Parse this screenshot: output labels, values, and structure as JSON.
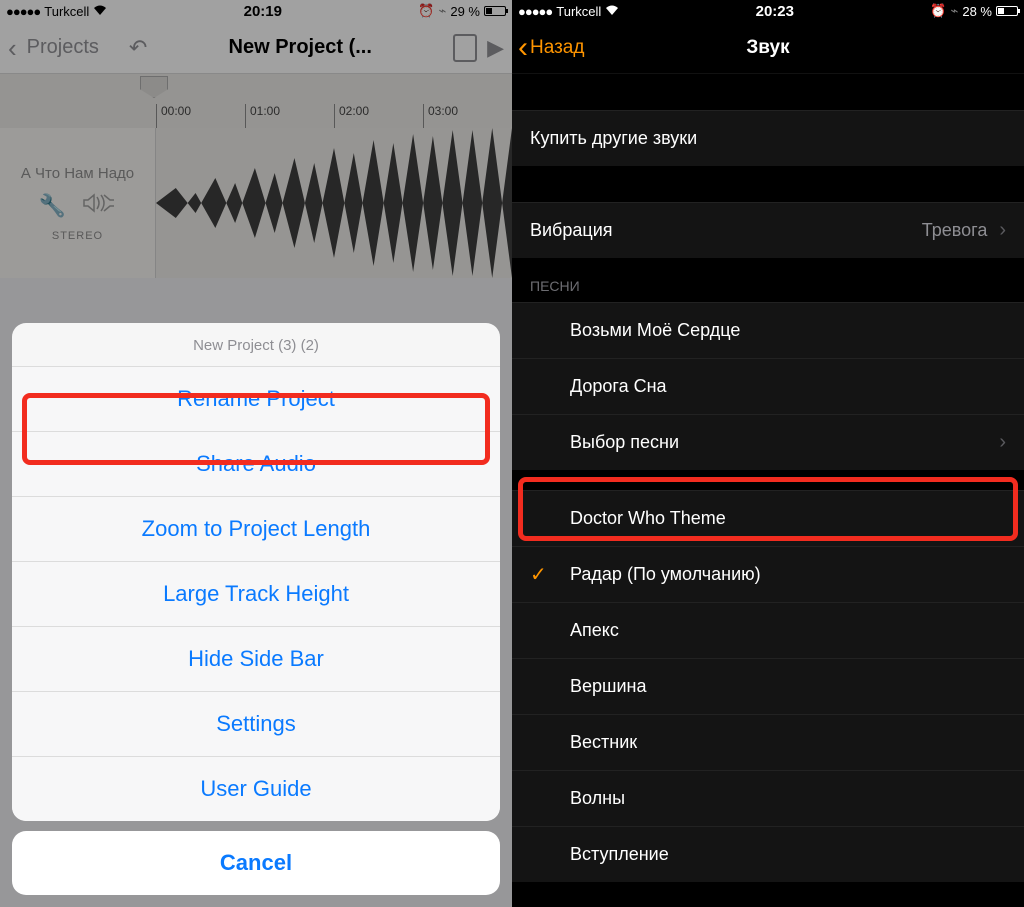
{
  "left": {
    "status": {
      "carrier": "Turkcell",
      "time": "20:19",
      "battery": "29 %"
    },
    "nav": {
      "back": "Projects",
      "title": "New Project (..."
    },
    "timeline": [
      "00:00",
      "01:00",
      "02:00",
      "03:00"
    ],
    "track": {
      "name": "А Что Нам Надо",
      "mode": "STEREO"
    },
    "sheet": {
      "title": "New Project (3) (2)",
      "items": [
        "Rename Project",
        "Share Audio",
        "Zoom to Project Length",
        "Large Track Height",
        "Hide Side Bar",
        "Settings",
        "User Guide"
      ],
      "cancel": "Cancel"
    },
    "highlighted_index": 1
  },
  "right": {
    "status": {
      "carrier": "Turkcell",
      "time": "20:23",
      "battery": "28 %"
    },
    "nav": {
      "back": "Назад",
      "title": "Звук"
    },
    "buy": "Купить другие звуки",
    "vibration": {
      "label": "Вибрация",
      "value": "Тревога"
    },
    "songs_header": "ПЕСНИ",
    "songs_top": [
      "Возьми Моё Сердце",
      "Дорога Сна"
    ],
    "song_picker": "Выбор песни",
    "songs_bottom": [
      "Doctor Who Theme",
      "Радар (По умолчанию)",
      "Апекс",
      "Вершина",
      "Вестник",
      "Волны",
      "Вступление"
    ],
    "default_index": 1
  }
}
